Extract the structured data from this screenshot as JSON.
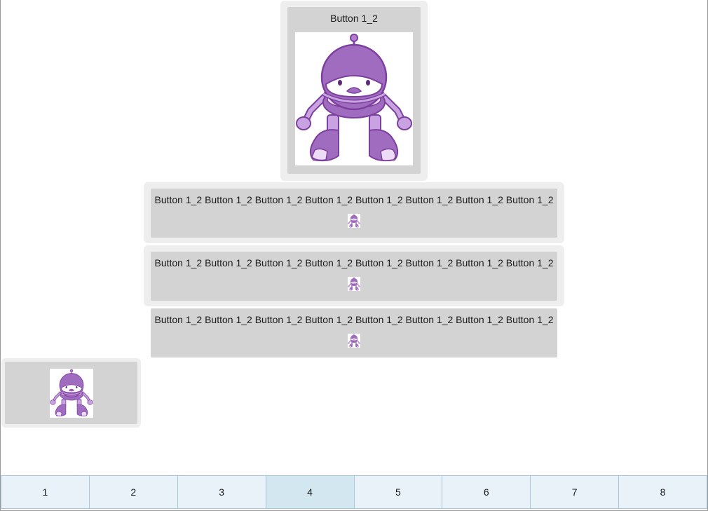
{
  "buttons": {
    "b1": {
      "label": "Button 1_2"
    },
    "b2": {
      "label": "Button 1_2 Button 1_2 Button 1_2 Button 1_2 Button 1_2 Button 1_2 Button 1_2 Button 1_2"
    },
    "b3": {
      "label": "Button 1_2 Button 1_2 Button 1_2 Button 1_2 Button 1_2 Button 1_2 Button 1_2 Button 1_2"
    },
    "b4": {
      "label": "Button 1_2 Button 1_2 Button 1_2 Button 1_2 Button 1_2 Button 1_2 Button 1_2 Button 1_2"
    }
  },
  "images": {
    "robot": "robot-mascot-icon"
  },
  "tabs": [
    {
      "label": "1"
    },
    {
      "label": "2"
    },
    {
      "label": "3"
    },
    {
      "label": "4",
      "selected": true
    },
    {
      "label": "5"
    },
    {
      "label": "6"
    },
    {
      "label": "7"
    },
    {
      "label": "8"
    }
  ],
  "colors": {
    "button_bg": "#d3d3d3",
    "focus_halo": "#eeeeee",
    "tab_bg": "#e8f2f8",
    "tab_selected_bg": "#d2e7ef",
    "tab_border": "#a9c7d8",
    "robot_purple": "#a06cc0"
  }
}
